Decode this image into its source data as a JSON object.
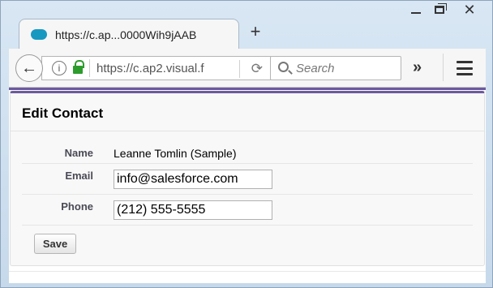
{
  "window": {
    "tab_title": "https://c.ap...0000Wih9jAAB",
    "new_tab": "+",
    "minimize": "",
    "maximize": "",
    "close": "✕"
  },
  "toolbar": {
    "url": "https://c.ap2.visual.f",
    "search_placeholder": "Search",
    "overflow_label": "»",
    "icons": [
      "back-arrow-icon",
      "info-icon",
      "lock-icon",
      "reload-icon",
      "search-icon",
      "menu-icon"
    ]
  },
  "colors": {
    "accent": "#6b5b9e",
    "tab_icon": "#1798c1",
    "lock": "#2d9c2d"
  },
  "form": {
    "title": "Edit Contact",
    "name_label": "Name",
    "name_value": "Leanne Tomlin (Sample)",
    "email_label": "Email",
    "email_value": "info@salesforce.com",
    "phone_label": "Phone",
    "phone_value": "(212) 555-5555",
    "save_label": "Save"
  }
}
